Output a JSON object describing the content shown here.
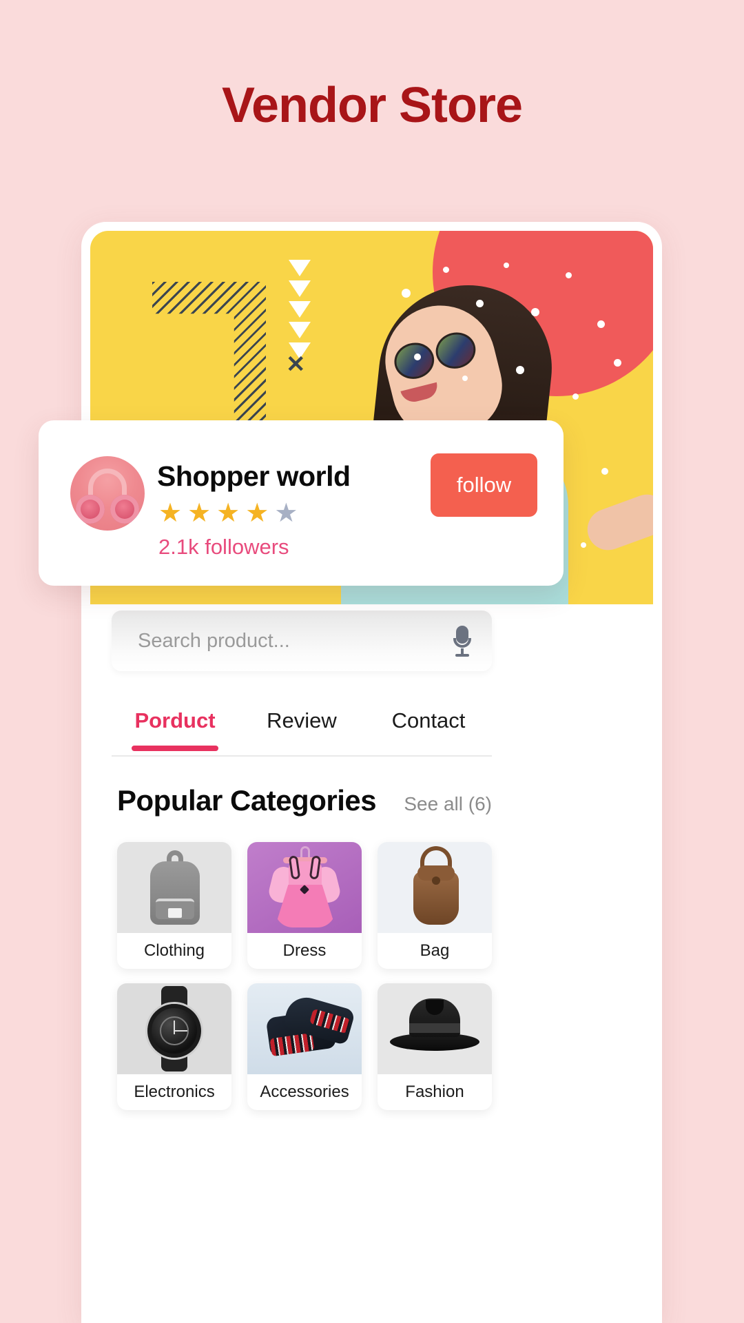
{
  "page": {
    "title": "Vendor Store",
    "title_color": "#a81518",
    "background_color": "#fadbdb"
  },
  "banner": {
    "name": "store-hero-banner",
    "background_color": "#f9d548",
    "accent_blob_color": "#f05a5a"
  },
  "store": {
    "name": "Shopper world",
    "rating": 4,
    "rating_max": 5,
    "star_on_color": "#f5b323",
    "star_off_color": "#a7b0c4",
    "followers": "2.1k followers",
    "followers_color": "#e84b7d",
    "follow_label": "follow",
    "follow_color": "#f4604f"
  },
  "search": {
    "placeholder": "Search product...",
    "value": "",
    "mic_icon": "microphone-icon"
  },
  "tabs": [
    {
      "label": "Porduct",
      "active": true
    },
    {
      "label": "Review",
      "active": false
    },
    {
      "label": "Contact",
      "active": false
    }
  ],
  "tab_accent_color": "#e8315f",
  "categories_section": {
    "title": "Popular Categories",
    "see_all": "See all (6)",
    "items": [
      {
        "label": "Clothing",
        "art": "clothing"
      },
      {
        "label": "Dress",
        "art": "dress"
      },
      {
        "label": "Bag",
        "art": "bag"
      },
      {
        "label": "Electronics",
        "art": "electronics"
      },
      {
        "label": "Accessories",
        "art": "accessories"
      },
      {
        "label": "Fashion",
        "art": "fashion"
      }
    ]
  }
}
